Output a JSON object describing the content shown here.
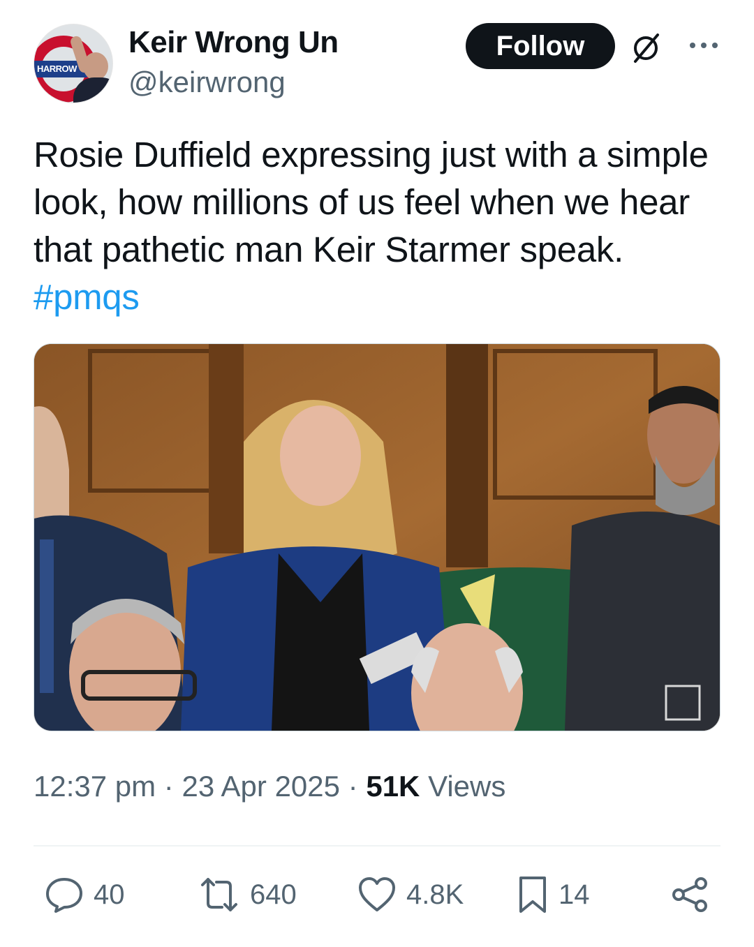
{
  "author": {
    "display_name": "Keir Wrong Un",
    "handle": "@keirwrong",
    "avatar_icon": "avatar-icon",
    "avatar_sign_text": "HARROW"
  },
  "header": {
    "follow_label": "Follow",
    "grok_icon": "slashed-circle-icon",
    "more_icon": "more-horizontal-icon"
  },
  "tweet": {
    "text": "Rosie Duffield expressing just with a simple look, how millions of us feel when we hear that pathetic man Keir Starmer speak.",
    "hashtag": "#pmqs",
    "hashtag_color": "#1d9bf0"
  },
  "meta": {
    "time": "12:37 pm",
    "separator": "·",
    "date": "23 Apr 2025",
    "views_count": "51K",
    "views_label": "Views"
  },
  "actions": {
    "replies": "40",
    "reposts": "640",
    "likes": "4.8K",
    "bookmarks": "14",
    "share_icon": "share-icon"
  },
  "colors": {
    "text": "#0f1419",
    "secondary": "#536471",
    "follow_bg": "#0f1419"
  }
}
